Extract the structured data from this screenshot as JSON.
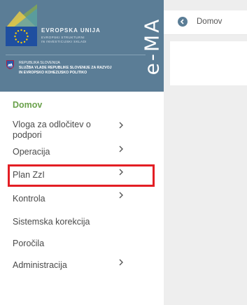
{
  "brand": {
    "eu_title": "EVROPSKA UNIJA",
    "eu_sub_1": "EVROPSKI STRUKTURNI",
    "eu_sub_2": "IN INVESTICIJSKI SKLADI",
    "gov_line_1": "REPUBLIKA SLOVENIJA",
    "gov_line_2": "SLUŽBA VLADE REPUBLIKE SLOVENIJE ZA RAZVOJ",
    "gov_line_3": "IN EVROPSKO KOHEZIJSKO POLITIKO",
    "app_logo": "e-MA",
    "color_brand": "#5b7d96",
    "color_active": "#6aa14b",
    "color_highlight": "#e31e24"
  },
  "breadcrumb": {
    "icon": "circle-arrow-left-icon",
    "label": "Domov"
  },
  "sidebar": {
    "items": [
      {
        "label": "Domov",
        "active": true,
        "has_submenu": false
      },
      {
        "label": "Vloga za odločitev o",
        "label_2": "podpori",
        "active": false,
        "has_submenu": true
      },
      {
        "label": "Operacija",
        "active": false,
        "has_submenu": true
      },
      {
        "label": "Plan ZzI",
        "active": false,
        "has_submenu": true,
        "highlighted": true
      },
      {
        "label": "Kontrola",
        "active": false,
        "has_submenu": true
      },
      {
        "label": "Sistemska korekcija",
        "active": false,
        "has_submenu": false
      },
      {
        "label": "Poročila",
        "active": false,
        "has_submenu": false
      },
      {
        "label": "Administracija",
        "active": false,
        "has_submenu": true
      }
    ]
  }
}
